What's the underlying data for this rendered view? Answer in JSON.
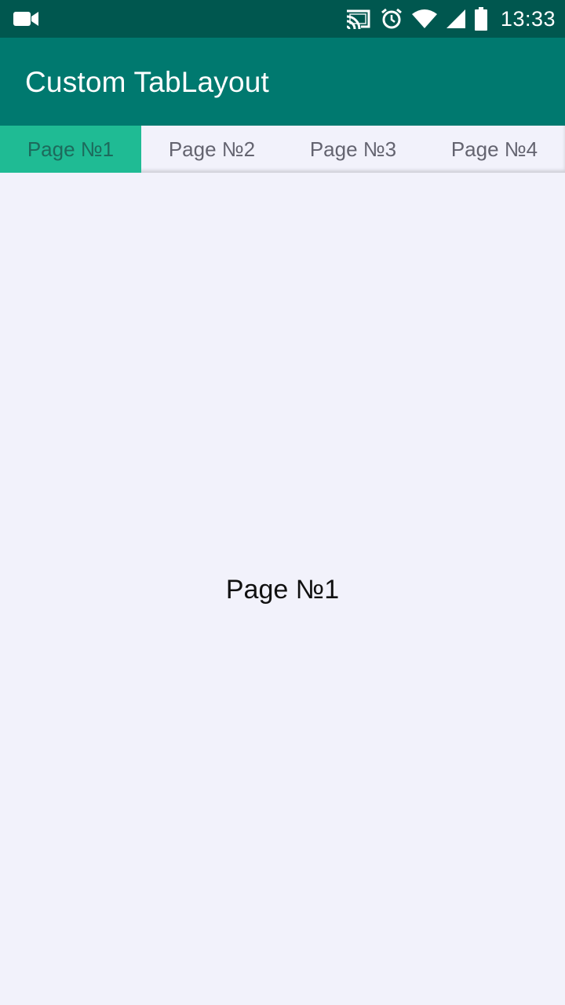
{
  "status_bar": {
    "left_icon": "video-camera-icon",
    "icons": [
      "cast-icon",
      "alarm-icon",
      "wifi-icon",
      "signal-icon",
      "battery-icon"
    ],
    "time": "13:33",
    "background_color": "#00574f"
  },
  "app_bar": {
    "title": "Custom TabLayout",
    "background_color": "#00796f"
  },
  "tabs": [
    {
      "label": "Page №1",
      "selected": true
    },
    {
      "label": "Page №2",
      "selected": false
    },
    {
      "label": "Page №3",
      "selected": false
    },
    {
      "label": "Page №4",
      "selected": false
    }
  ],
  "tab_colors": {
    "selected_background": "#1fbb94",
    "selected_text": "#1d6a5c",
    "unselected_text": "#646470"
  },
  "content": {
    "page_label": "Page №1",
    "background_color": "#f2f2fb"
  }
}
